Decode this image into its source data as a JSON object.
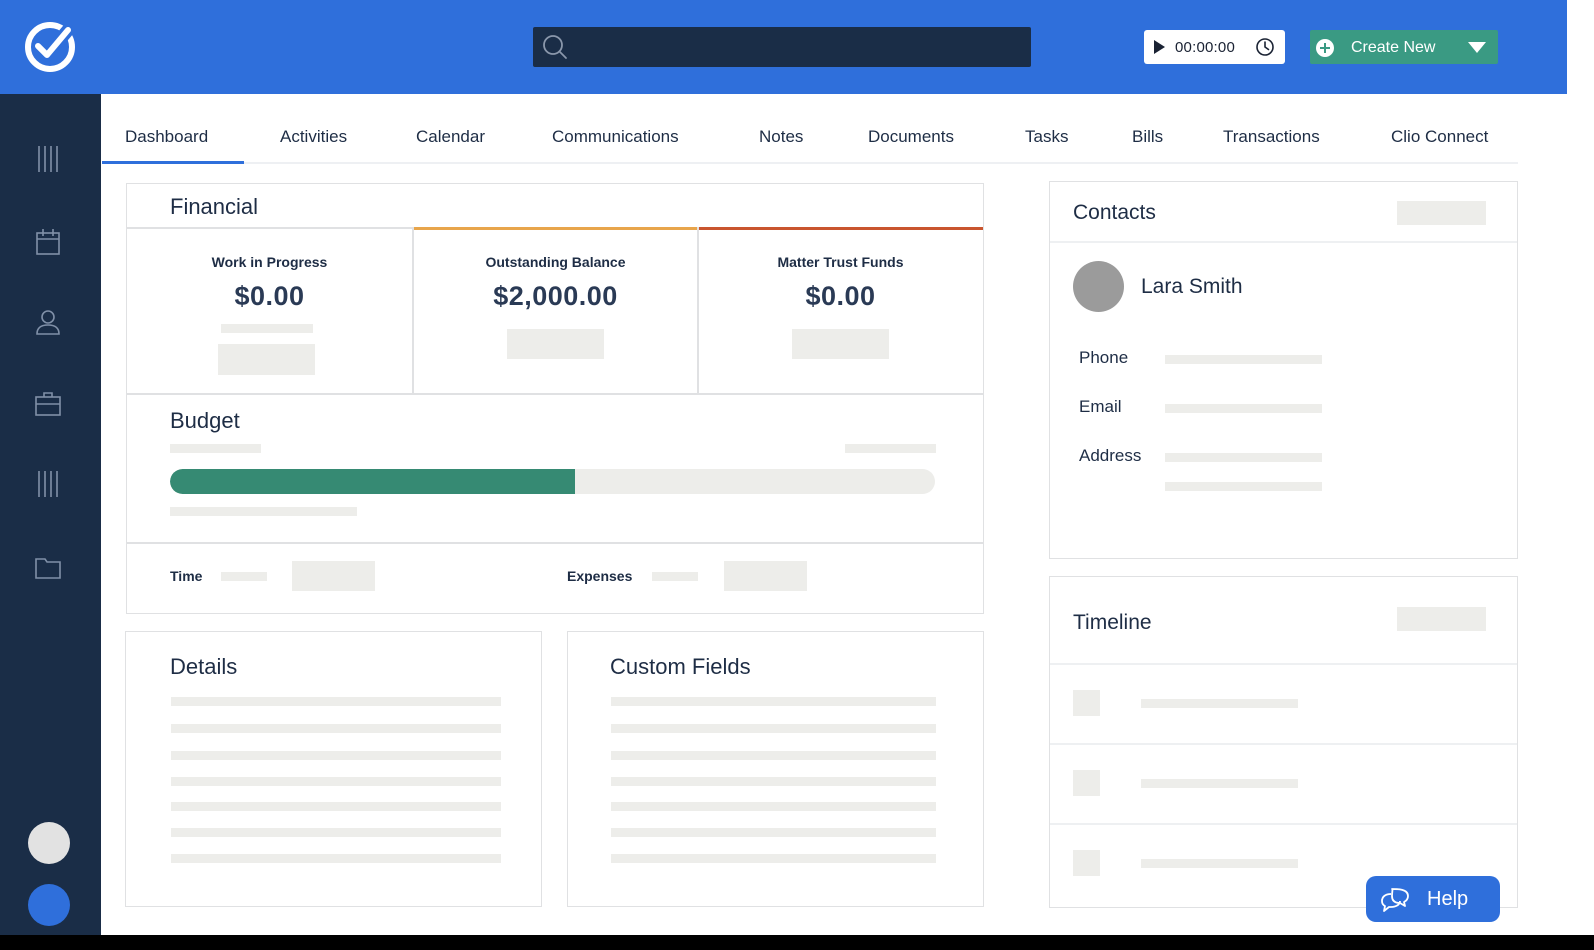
{
  "header": {
    "search_placeholder": "",
    "timer": "00:00:00",
    "create_label": "Create New"
  },
  "tabs": [
    {
      "label": "Dashboard",
      "active": true
    },
    {
      "label": "Activities"
    },
    {
      "label": "Calendar"
    },
    {
      "label": "Communications"
    },
    {
      "label": "Notes"
    },
    {
      "label": "Documents"
    },
    {
      "label": "Tasks"
    },
    {
      "label": "Bills"
    },
    {
      "label": "Transactions"
    },
    {
      "label": "Clio Connect"
    }
  ],
  "sidebar": {
    "icons": [
      "list-icon",
      "calendar-icon",
      "person-icon",
      "briefcase-icon",
      "list-icon",
      "folder-icon"
    ]
  },
  "financial": {
    "title": "Financial",
    "stats": [
      {
        "label": "Work in Progress",
        "value": "$0.00"
      },
      {
        "label": "Outstanding Balance",
        "value": "$2,000.00",
        "accent": "#e8a54b"
      },
      {
        "label": "Matter Trust Funds",
        "value": "$0.00",
        "accent": "#c9552f"
      }
    ],
    "budget": {
      "title": "Budget",
      "progress": 0.53
    },
    "time_label": "Time",
    "expenses_label": "Expenses"
  },
  "details": {
    "title": "Details"
  },
  "custom_fields": {
    "title": "Custom Fields"
  },
  "contacts": {
    "title": "Contacts",
    "name": "Lara Smith",
    "phone_label": "Phone",
    "email_label": "Email",
    "address_label": "Address"
  },
  "timeline": {
    "title": "Timeline"
  },
  "help": {
    "label": "Help"
  },
  "colors": {
    "brand": "#2f6fdb",
    "navy": "#1a2d47",
    "green": "#368a73",
    "orange": "#e8a54b",
    "red": "#c9552f"
  }
}
